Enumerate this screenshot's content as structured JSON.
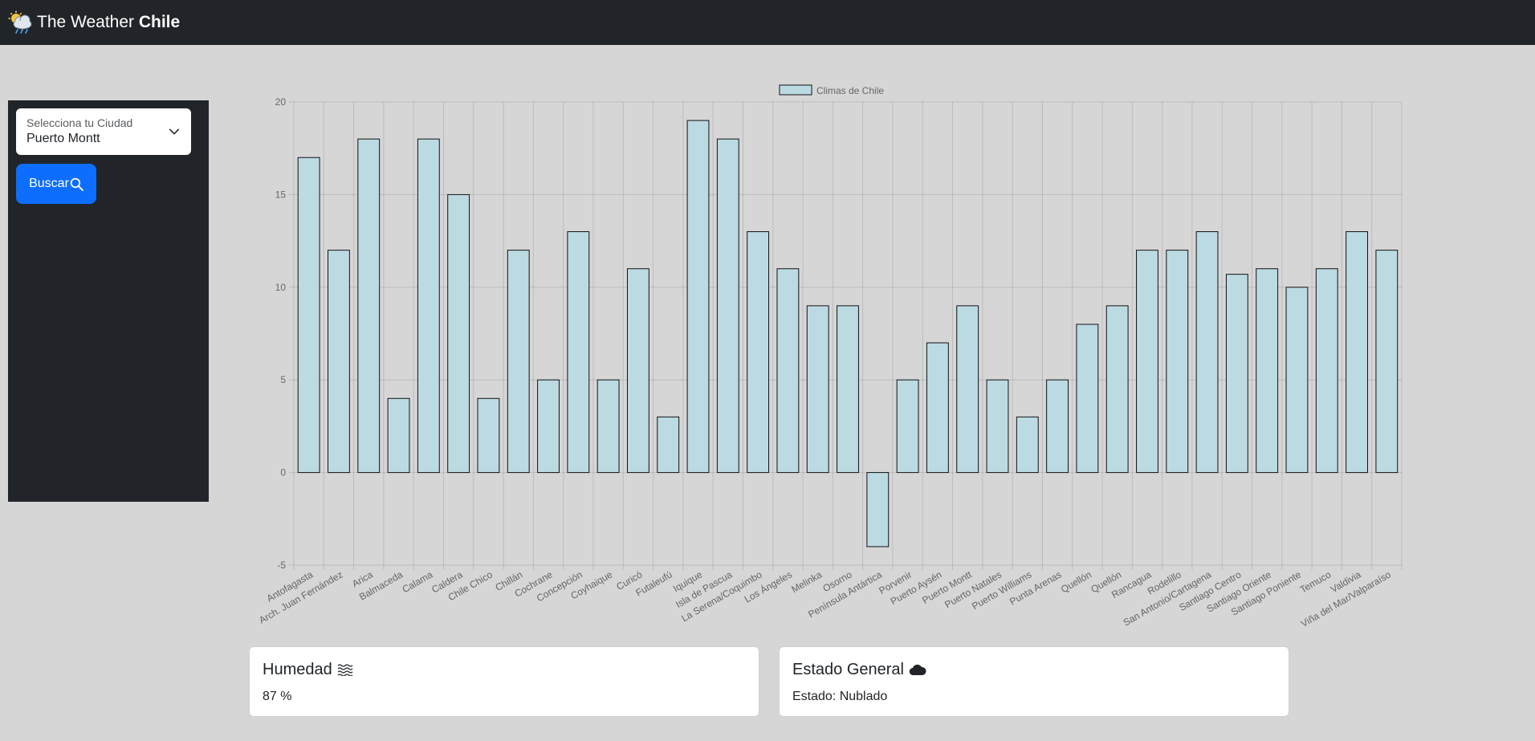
{
  "navbar": {
    "brand_prefix": "The Weather",
    "brand_strong": "Chile",
    "logo_icon": "cloud-sun-rain-icon"
  },
  "sidebar": {
    "select_label": "Selecciona tu Ciudad",
    "select_value": "Puerto Montt",
    "search_label": "Buscar",
    "search_icon": "search-icon"
  },
  "colors": {
    "navbar": "#212529",
    "accent": "#0d6efd",
    "bar_fill": "#bcdae2",
    "bar_stroke": "#111111",
    "background": "#d7d6d7"
  },
  "chart_data": {
    "type": "bar",
    "legend": "Climas de Chile",
    "legend_position": "top",
    "grid": true,
    "ylim": [
      -5,
      20
    ],
    "yticks": [
      -5,
      0,
      5,
      10,
      15,
      20
    ],
    "categories": [
      "Antofagasta",
      "Arch. Juan Fernández",
      "Arica",
      "Balmaceda",
      "Calama",
      "Caldera",
      "Chile Chico",
      "Chillán",
      "Cochrane",
      "Concepción",
      "Coyhaique",
      "Curicó",
      "Futaleufú",
      "Iquique",
      "Isla de Pascua",
      "La Serena/Coquimbo",
      "Los Ángeles",
      "Melinka",
      "Osorno",
      "Península Antártica",
      "Porvenir",
      "Puerto Aysén",
      "Puerto Montt",
      "Puerto Natales",
      "Puerto Williams",
      "Punta Arenas",
      "Quellón",
      "Quellón",
      "Rancagua",
      "Rodelillo",
      "San Antonio/Cartagena",
      "Santiago Centro",
      "Santiago Oriente",
      "Santiago Poniente",
      "Temuco",
      "Valdivia",
      "Viña del Mar/Valparaíso"
    ],
    "series": [
      {
        "name": "Climas de Chile",
        "values": [
          17,
          12,
          18,
          4,
          18,
          15,
          4,
          12,
          5,
          13,
          5,
          11,
          3,
          19,
          18,
          13,
          11,
          9,
          9,
          -4,
          5,
          7,
          9,
          5,
          3,
          5,
          8,
          9,
          12,
          12,
          13,
          10.7,
          11,
          10,
          11,
          13,
          12
        ]
      }
    ]
  },
  "cards": {
    "humidity": {
      "title": "Humedad",
      "icon": "water-waves-icon",
      "text": "87 %"
    },
    "status": {
      "title": "Estado General",
      "icon": "cloud-icon",
      "text": "Estado: Nublado"
    }
  }
}
